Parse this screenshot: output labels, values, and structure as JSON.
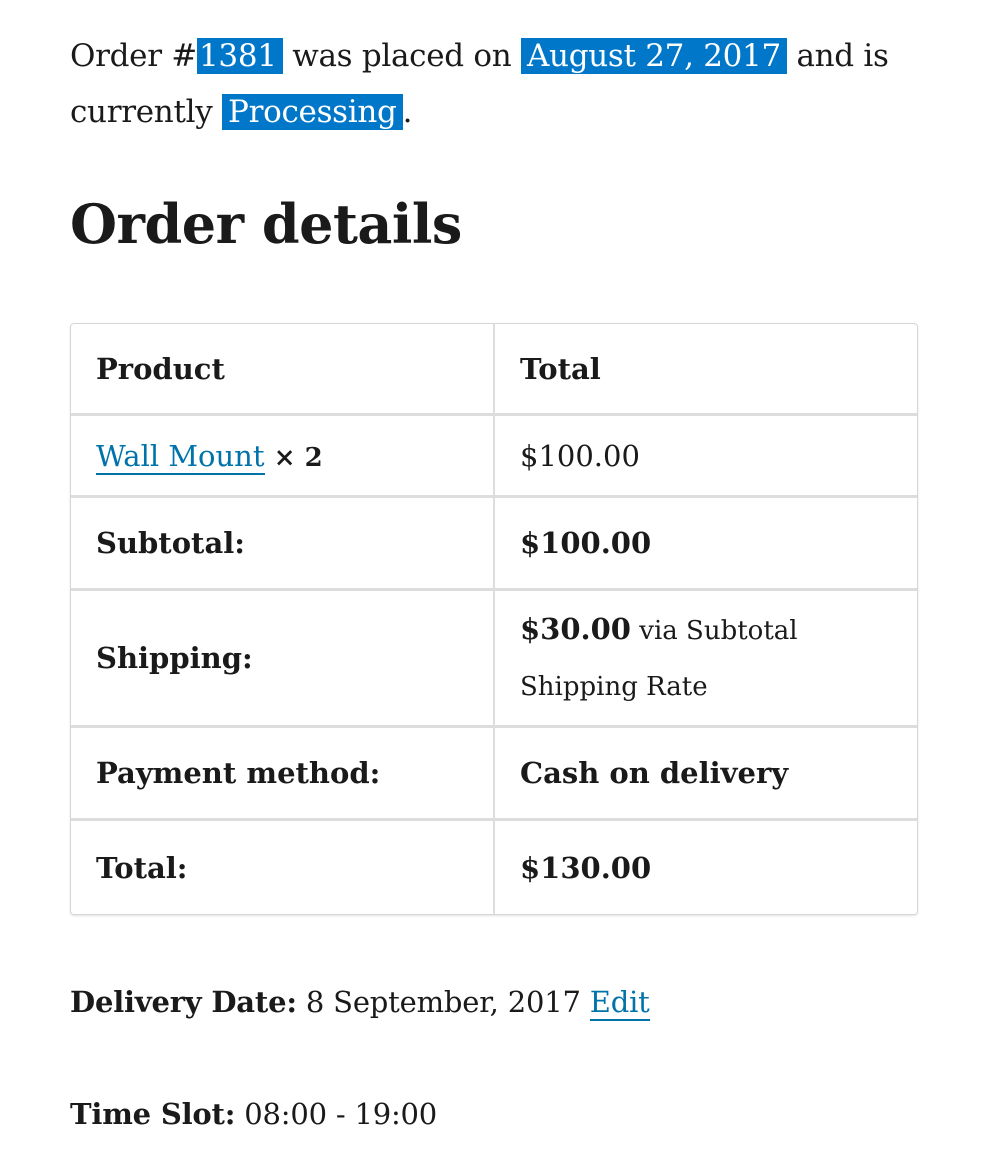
{
  "intro": {
    "prefix": "Order #",
    "order_number": "1381",
    "middle": " was placed on ",
    "order_date": "August 27, 2017",
    "suffix_1": " and is currently ",
    "status": "Processing",
    "suffix_2": "."
  },
  "heading": "Order details",
  "table": {
    "headers": {
      "product": "Product",
      "total": "Total"
    },
    "items": [
      {
        "name": "Wall Mount",
        "qty": "× 2",
        "total": "$100.00"
      }
    ],
    "subtotal": {
      "label": "Subtotal:",
      "value": "$100.00"
    },
    "shipping": {
      "label": "Shipping:",
      "amount": "$30.00",
      "method": "via Subtotal Shipping Rate"
    },
    "payment": {
      "label": "Payment method:",
      "value": "Cash on delivery"
    },
    "total": {
      "label": "Total:",
      "value": "$130.00"
    }
  },
  "delivery": {
    "label": "Delivery Date:",
    "value": "8 September, 2017",
    "edit_label": "Edit"
  },
  "time_slot": {
    "label": "Time Slot:",
    "value": "08:00 - 19:00"
  },
  "colors": {
    "highlight": "#0077c8",
    "link": "#0073aa"
  }
}
